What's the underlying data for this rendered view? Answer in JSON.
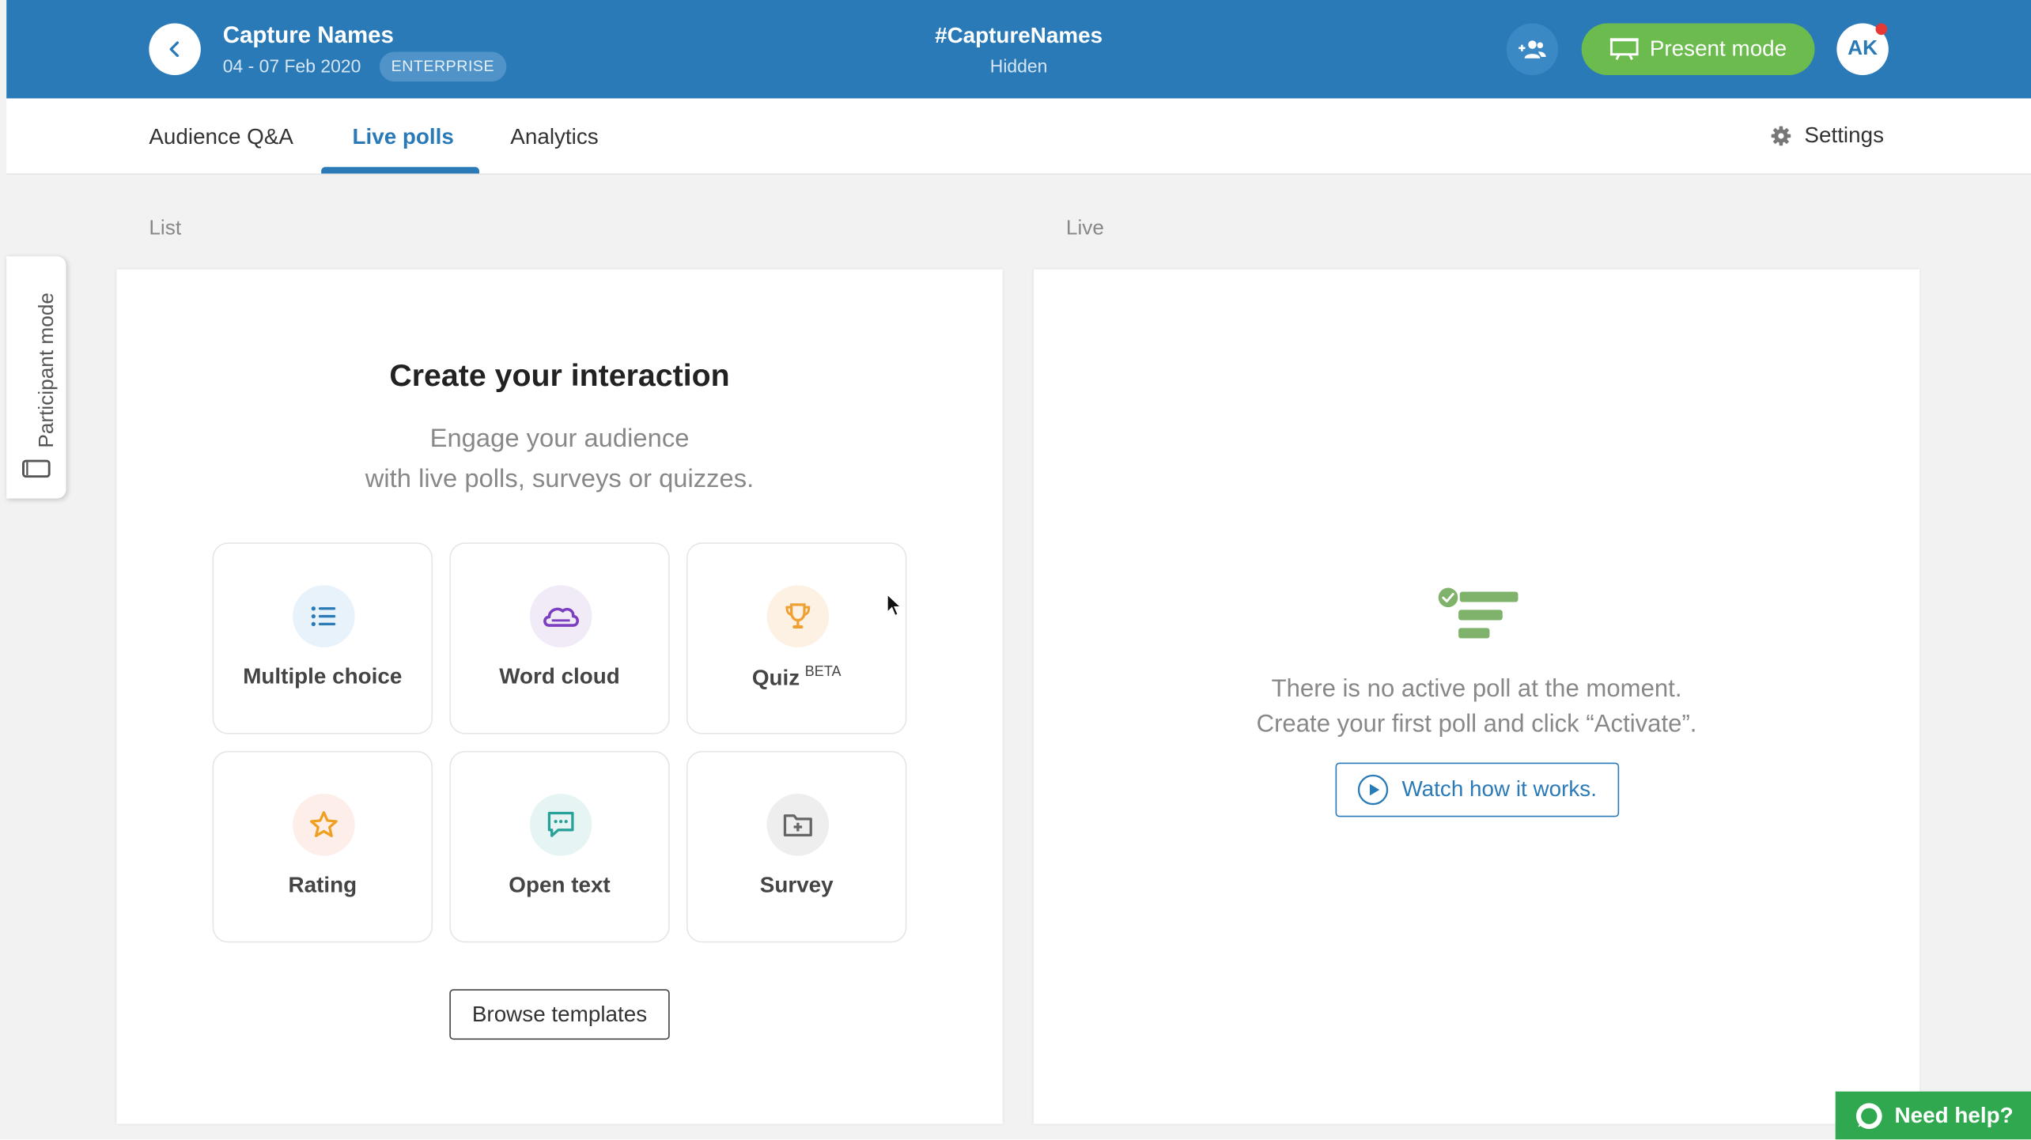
{
  "header": {
    "title": "Capture Names",
    "dates": "04 - 07 Feb 2020",
    "plan_badge": "ENTERPRISE",
    "hashtag": "#CaptureNames",
    "visibility": "Hidden",
    "present_label": "Present mode",
    "avatar_initials": "AK"
  },
  "tabs": [
    {
      "label": "Audience Q&A",
      "active": false
    },
    {
      "label": "Live polls",
      "active": true
    },
    {
      "label": "Analytics",
      "active": false
    }
  ],
  "settings_label": "Settings",
  "participant_mode_label": "Participant mode",
  "sections": {
    "list": "List",
    "live": "Live"
  },
  "create": {
    "title": "Create your interaction",
    "subtitle_line1": "Engage your audience",
    "subtitle_line2": "with live polls, surveys or quizzes.",
    "types": [
      {
        "label": "Multiple choice",
        "icon": "list-icon"
      },
      {
        "label": "Word cloud",
        "icon": "cloud-icon"
      },
      {
        "label": "Quiz",
        "badge": "BETA",
        "icon": "trophy-icon"
      },
      {
        "label": "Rating",
        "icon": "star-icon"
      },
      {
        "label": "Open text",
        "icon": "chat-icon"
      },
      {
        "label": "Survey",
        "icon": "folder-plus-icon"
      }
    ],
    "browse_label": "Browse templates"
  },
  "live": {
    "empty_line1": "There is no active poll at the moment.",
    "empty_line2": "Create your first poll and click “Activate”.",
    "watch_label": "Watch how it works."
  },
  "help_label": "Need help?",
  "colors": {
    "brand_blue": "#2a7ab8",
    "present_green": "#6cbb4e",
    "help_green": "#2fa84f"
  }
}
